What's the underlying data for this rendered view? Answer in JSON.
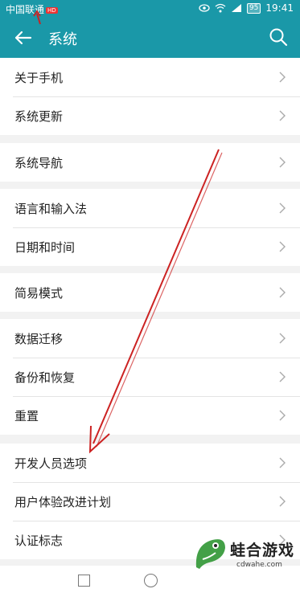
{
  "status_bar": {
    "carrier": "中国联通",
    "carrier_badge": "HD",
    "battery": "95",
    "time": "19:41",
    "icons": [
      "eye-icon",
      "wifi-icon",
      "signal-icon",
      "battery-icon"
    ]
  },
  "header": {
    "title": "系统",
    "back_icon": "arrow-left-icon",
    "search_icon": "search-icon",
    "background": "#1a98a8"
  },
  "settings": {
    "group1": [
      {
        "label": "关于手机"
      },
      {
        "label": "系统更新"
      }
    ],
    "group2": [
      {
        "label": "系统导航"
      }
    ],
    "group3": [
      {
        "label": "语言和输入法"
      },
      {
        "label": "日期和时间"
      }
    ],
    "group4": [
      {
        "label": "简易模式"
      }
    ],
    "group5": [
      {
        "label": "数据迁移"
      },
      {
        "label": "备份和恢复"
      },
      {
        "label": "重置"
      }
    ],
    "group6": [
      {
        "label": "开发人员选项"
      },
      {
        "label": "用户体验改进计划"
      },
      {
        "label": "认证标志"
      }
    ]
  },
  "watermark": {
    "name": "蛙合游戏",
    "url": "cdwahe.com"
  },
  "colors": {
    "accent": "#1a98a8",
    "annotation_arrow": "#cc2222"
  }
}
